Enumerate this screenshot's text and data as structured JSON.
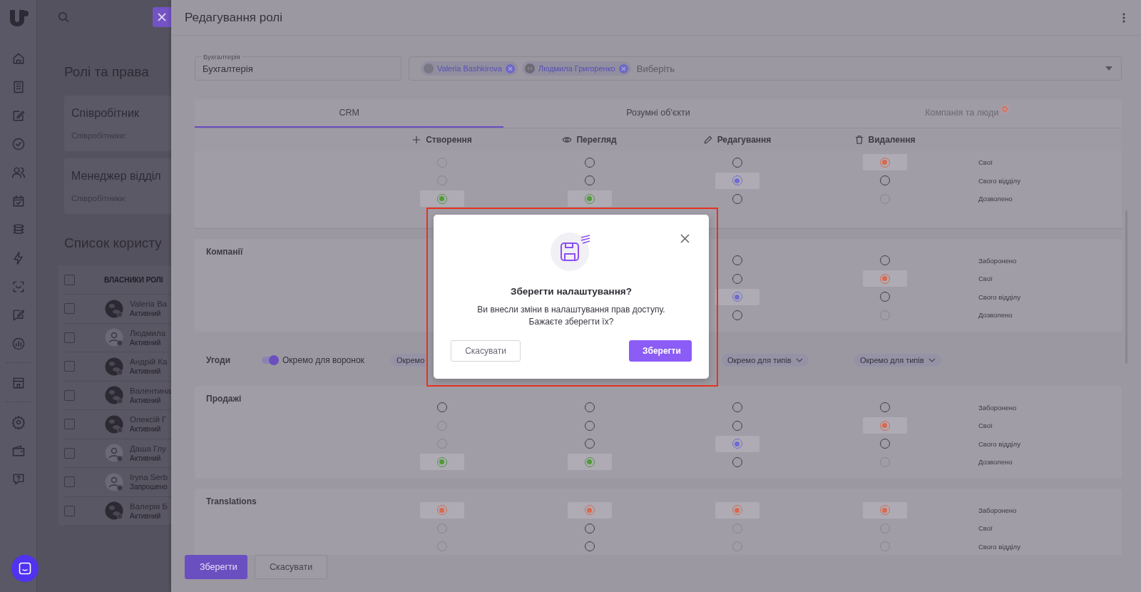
{
  "background_page": {
    "title": "Ролі та права",
    "cards": [
      {
        "title": "Співробітник",
        "subtitle": "Співробітники:"
      },
      {
        "title": "Менеджер відділ",
        "subtitle": "Співробітники:"
      }
    ],
    "users_title": "Список користу",
    "table": {
      "header": "ВЛАСНИКИ РОЛІ",
      "all_checked": false,
      "rows": [
        {
          "name": "Valeria Ba",
          "status": "Активний",
          "photo": true,
          "checked": false
        },
        {
          "name": "Людмила",
          "status": "Активний",
          "photo": false,
          "checked": false
        },
        {
          "name": "Андрій Ка",
          "status": "Активний",
          "photo": true,
          "checked": false
        },
        {
          "name": "Валентина",
          "status": "Активний",
          "photo": true,
          "checked": false
        },
        {
          "name": "Олексій Г",
          "status": "Активний",
          "photo": true,
          "checked": false
        },
        {
          "name": "Даша Глу",
          "status": "Активний",
          "photo": false,
          "checked": false
        },
        {
          "name": "Iryna Serb",
          "status": "Запрошено",
          "photo": false,
          "checked": false
        },
        {
          "name": "Валерія Б",
          "status": "Активний",
          "photo": true,
          "checked": false
        }
      ]
    }
  },
  "drawer": {
    "title": "Редагування ролі",
    "name_field": {
      "label": "Бухгалтерія",
      "value": "Бухгалтерія"
    },
    "owners": {
      "chips": [
        {
          "label": "Valeria Bashkirova",
          "photo": true
        },
        {
          "label": "Людмила Григоренко",
          "photo": false
        }
      ],
      "placeholder": "Виберіть"
    },
    "tabs": [
      {
        "label": "CRM",
        "selected": true,
        "alert": false
      },
      {
        "label": "Розумні об’єкти",
        "selected": false,
        "alert": false
      },
      {
        "label": "Компанія та люди",
        "selected": false,
        "alert": true
      }
    ],
    "columns": [
      "Створення",
      "Перегляд",
      "Редагування",
      "Видалення"
    ],
    "sections": [
      {
        "kind": "matrix",
        "rows": [
          {
            "level": "Свої",
            "cells": [
              {
                "selected": false,
                "disabled": true
              },
              {
                "selected": false,
                "disabled": false
              },
              {
                "selected": false,
                "disabled": false
              },
              {
                "selected": true,
                "disabled": false,
                "color": "#d9694e"
              }
            ]
          },
          {
            "level": "Свого відділу",
            "cells": [
              {
                "selected": false,
                "disabled": true
              },
              {
                "selected": false,
                "disabled": false
              },
              {
                "selected": true,
                "disabled": false,
                "color": "#6f6bd0"
              },
              {
                "selected": false,
                "disabled": false
              }
            ]
          },
          {
            "level": "Дозволено",
            "cells": [
              {
                "selected": true,
                "disabled": false,
                "color": "#4f9a3a"
              },
              {
                "selected": true,
                "disabled": false,
                "color": "#4f9a3a"
              },
              {
                "selected": false,
                "disabled": false
              },
              {
                "selected": false,
                "disabled": true
              }
            ]
          }
        ]
      },
      {
        "kind": "matrix",
        "title": "Компанії",
        "rows": [
          {
            "level": "Заборонено",
            "cells": [
              {
                "selected": false,
                "disabled": false
              },
              {
                "selected": false,
                "disabled": false
              }
            ]
          },
          {
            "level": "Свої",
            "cells": [
              {
                "selected": false,
                "disabled": false
              },
              {
                "selected": true,
                "disabled": false,
                "color": "#d9694e"
              }
            ]
          },
          {
            "level": "Свого відділу",
            "cells": [
              {
                "selected": true,
                "disabled": false,
                "color": "#6f6bd0"
              },
              {
                "selected": false,
                "disabled": false
              }
            ]
          },
          {
            "level": "Дозволено",
            "cells": [
              {
                "selected": false,
                "disabled": false
              },
              {
                "selected": false,
                "disabled": true
              }
            ]
          }
        ]
      },
      {
        "kind": "toggle_row",
        "title": "Угоди",
        "toggle": {
          "label": "Окремо для воронок",
          "on": true
        },
        "dropdowns": [
          {
            "label": "Окремо",
            "cut": true
          },
          {
            "label": "Окремо для типів",
            "cut": false
          },
          {
            "label": "Окремо для типів",
            "cut": false
          }
        ]
      },
      {
        "kind": "matrix",
        "title": "Продажі",
        "rows": [
          {
            "level": "Заборонено",
            "cells": [
              {
                "selected": false,
                "disabled": false
              },
              {
                "selected": false,
                "disabled": false
              },
              {
                "selected": false,
                "disabled": false
              },
              {
                "selected": false,
                "disabled": false
              }
            ]
          },
          {
            "level": "Свої",
            "cells": [
              {
                "selected": false,
                "disabled": true
              },
              {
                "selected": false,
                "disabled": false
              },
              {
                "selected": false,
                "disabled": false
              },
              {
                "selected": true,
                "disabled": false,
                "color": "#d9694e"
              }
            ]
          },
          {
            "level": "Свого відділу",
            "cells": [
              {
                "selected": false,
                "disabled": true
              },
              {
                "selected": false,
                "disabled": false
              },
              {
                "selected": true,
                "disabled": false,
                "color": "#6f6bd0"
              },
              {
                "selected": false,
                "disabled": false
              }
            ]
          },
          {
            "level": "Дозволено",
            "cells": [
              {
                "selected": true,
                "disabled": false,
                "color": "#4f9a3a"
              },
              {
                "selected": true,
                "disabled": false,
                "color": "#4f9a3a"
              },
              {
                "selected": false,
                "disabled": false
              },
              {
                "selected": false,
                "disabled": true
              }
            ]
          }
        ]
      },
      {
        "kind": "matrix",
        "title": "Translations",
        "rows": [
          {
            "level": "Заборонено",
            "cells": [
              {
                "selected": true,
                "disabled": false,
                "color": "#d9694e"
              },
              {
                "selected": true,
                "disabled": false,
                "color": "#d9694e"
              },
              {
                "selected": true,
                "disabled": false,
                "color": "#d9694e"
              },
              {
                "selected": true,
                "disabled": false,
                "color": "#d9694e"
              }
            ]
          },
          {
            "level": "Свої",
            "cells": [
              {
                "selected": false,
                "disabled": true
              },
              {
                "selected": false,
                "disabled": false
              },
              {
                "selected": false,
                "disabled": true
              },
              {
                "selected": false,
                "disabled": true
              }
            ]
          },
          {
            "level": "Свого відділу",
            "cells": [
              {
                "selected": false,
                "disabled": true
              },
              {
                "selected": false,
                "disabled": false
              },
              {
                "selected": false,
                "disabled": true
              },
              {
                "selected": false,
                "disabled": true
              }
            ]
          }
        ]
      }
    ],
    "footer": {
      "save": "Зберегти",
      "cancel": "Скасувати"
    }
  },
  "modal": {
    "title": "Зберегти налаштування?",
    "message": "Ви внесли зміни в налаштування прав доступу. Бажаєте зберегти їх?",
    "cancel": "Скасувати",
    "confirm": "Зберегти"
  }
}
